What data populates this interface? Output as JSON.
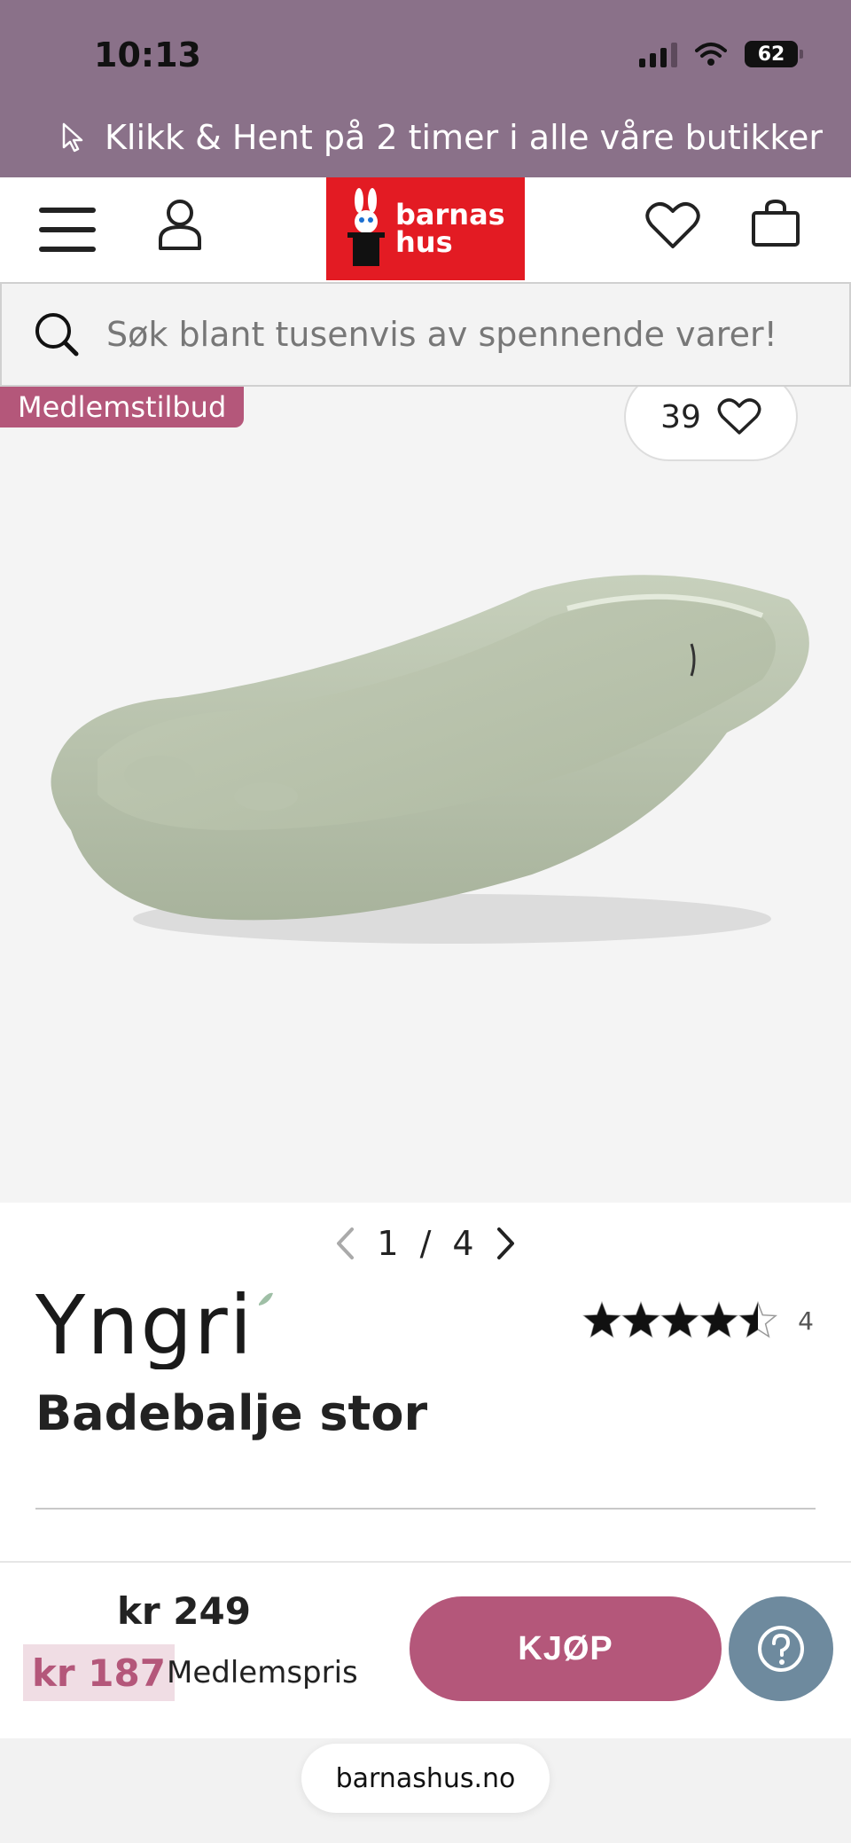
{
  "status_bar": {
    "time": "10:13",
    "battery": "62"
  },
  "promo_banner": {
    "text": "Klikk & Hent på 2 timer i alle våre butikker"
  },
  "header": {
    "logo_line1": "barnas",
    "logo_line2": "hus"
  },
  "search": {
    "placeholder": "Søk blant tusenvis av spennende varer!"
  },
  "gallery": {
    "badge": "Medlemstilbud",
    "favorite_count": "39",
    "page_current": "1",
    "page_separator": "/",
    "page_total": "4"
  },
  "product": {
    "brand": "Yngri",
    "title": "Badebalje stor",
    "rating": 4.5,
    "rating_count": "4"
  },
  "buy_bar": {
    "regular_price": "kr 249",
    "member_price": "kr 187",
    "member_label": "Medlemspris",
    "buy_label": "KJØP"
  },
  "browser": {
    "domain": "barnashus.no"
  },
  "colors": {
    "topbar": "#8a7189",
    "accent": "#b4577a",
    "logo_red": "#e31b23",
    "help": "#6e8a9e",
    "product_green": "#b7c3aa"
  }
}
